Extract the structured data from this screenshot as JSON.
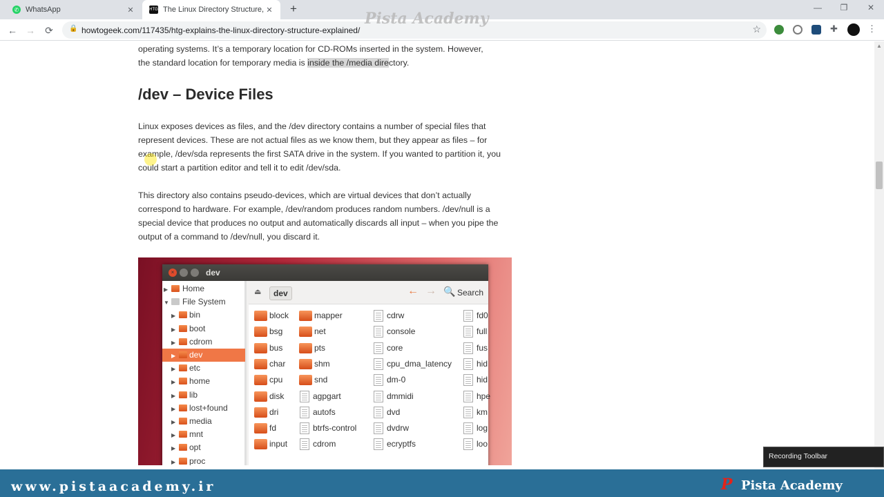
{
  "browser": {
    "tabs": [
      {
        "title": "WhatsApp",
        "icon": "whatsapp-icon"
      },
      {
        "title": "The Linux Directory Structure, Ex",
        "icon": "htg-icon",
        "favicon_text": "HTG"
      }
    ],
    "url": "howtogeek.com/117435/htg-explains-the-linux-directory-structure-explained/"
  },
  "watermark": "Pista Academy",
  "article": {
    "intro_line1": "operating systems. It’s a temporary location for CD-ROMs inserted in the system. However,",
    "intro_line2_before": "the standard location for temporary media is ",
    "intro_line2_highlight": "inside the /media dire",
    "intro_line2_after": "ctory.",
    "heading": "/dev – Device Files",
    "para1": "Linux exposes devices as files, and the /dev directory contains a number of special files that represent devices. These are not actual files as we know them, but they appear as files – for example, /dev/sda represents the first SATA drive in the system. If you wanted to partition it, you could start a partition editor and tell it to edit /dev/sda.",
    "para2": "This directory also contains pseudo-devices, which are virtual devices that don’t actually correspond to hardware. For example, /dev/random produces random numbers. /dev/null is a special device that produces no output and automatically discards all input – when you pipe the output of a command to /dev/null, you discard it."
  },
  "file_manager": {
    "title": "dev",
    "path": "dev",
    "search": "Search",
    "sidebar": [
      "Home",
      "File System",
      "bin",
      "boot",
      "cdrom",
      "dev",
      "etc",
      "home",
      "lib",
      "lost+found",
      "media",
      "mnt",
      "opt",
      "proc"
    ],
    "col1": [
      "block",
      "bsg",
      "bus",
      "char",
      "cpu",
      "disk",
      "dri",
      "fd",
      "input"
    ],
    "col2": [
      "mapper",
      "net",
      "pts",
      "shm",
      "snd",
      "agpgart",
      "autofs",
      "btrfs-control",
      "cdrom"
    ],
    "col3": [
      "cdrw",
      "console",
      "core",
      "cpu_dma_latency",
      "dm-0",
      "dmmidi",
      "dvd",
      "dvdrw",
      "ecryptfs"
    ],
    "col4": [
      "fd0",
      "full",
      "fus",
      "hid",
      "hid",
      "hpe",
      "km",
      "log",
      "loo"
    ]
  },
  "footer": {
    "site": "www.pistaacademy.ir",
    "logo": "P",
    "brand": "Pista Academy"
  },
  "recording_toolbar": "Recording Toolbar"
}
